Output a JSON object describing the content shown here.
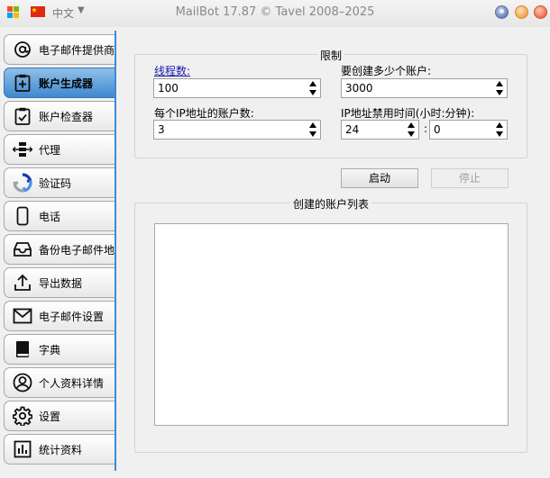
{
  "window": {
    "title": "MailBot 17.87 © Tavel 2008–2025",
    "language": "中文"
  },
  "sidebar": {
    "items": [
      {
        "label": "电子邮件提供商",
        "icon": "at-sign-icon",
        "active": false
      },
      {
        "label": "账户生成器",
        "icon": "clipboard-plus-icon",
        "active": true
      },
      {
        "label": "账户检查器",
        "icon": "clipboard-check-icon",
        "active": false
      },
      {
        "label": "代理",
        "icon": "proxy-server-icon",
        "active": false
      },
      {
        "label": "验证码",
        "icon": "recaptcha-icon",
        "active": false
      },
      {
        "label": "电话",
        "icon": "phone-icon",
        "active": false
      },
      {
        "label": "备份电子邮件地",
        "icon": "inbox-tray-icon",
        "active": false
      },
      {
        "label": "导出数据",
        "icon": "upload-icon",
        "active": false
      },
      {
        "label": "电子邮件设置",
        "icon": "envelope-icon",
        "active": false
      },
      {
        "label": "字典",
        "icon": "book-icon",
        "active": false
      },
      {
        "label": "个人资料详情",
        "icon": "user-profile-icon",
        "active": false
      },
      {
        "label": "设置",
        "icon": "gear-icon",
        "active": false
      },
      {
        "label": "统计资料",
        "icon": "bar-chart-icon",
        "active": false
      }
    ]
  },
  "limits": {
    "title": "限制",
    "threads_label": "线程数:",
    "threads_value": "100",
    "accounts_label": "要创建多少个账户:",
    "accounts_value": "3000",
    "per_ip_label": "每个IP地址的账户数:",
    "per_ip_value": "3",
    "ban_label": "IP地址禁用时间(小时:分钟):",
    "ban_hours": "24",
    "ban_minutes": "0",
    "colon": ":"
  },
  "actions": {
    "start_label": "启动",
    "stop_label": "停止"
  },
  "created": {
    "title": "创建的账户列表"
  }
}
